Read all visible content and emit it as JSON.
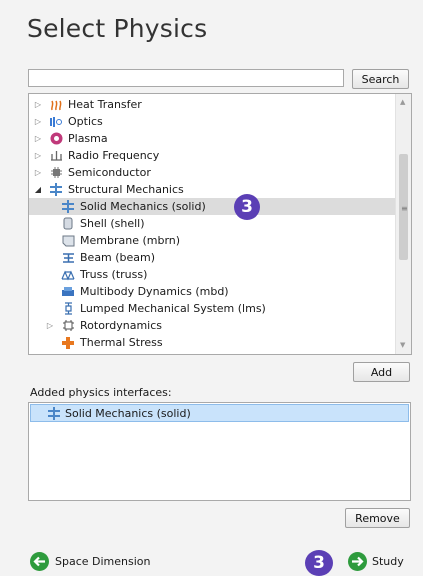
{
  "title": "Select Physics",
  "search": {
    "placeholder": "",
    "button_label": "Search"
  },
  "tree": {
    "items": [
      {
        "label": "Heat Transfer",
        "icon": "heat-transfer-icon",
        "expander": "collapsed"
      },
      {
        "label": "Optics",
        "icon": "optics-icon",
        "expander": "collapsed"
      },
      {
        "label": "Plasma",
        "icon": "plasma-icon",
        "expander": "collapsed"
      },
      {
        "label": "Radio Frequency",
        "icon": "radio-frequency-icon",
        "expander": "collapsed"
      },
      {
        "label": "Semiconductor",
        "icon": "semiconductor-icon",
        "expander": "collapsed"
      },
      {
        "label": "Structural Mechanics",
        "icon": "structural-mechanics-icon",
        "expander": "expanded"
      },
      {
        "label": "Solid Mechanics (solid)",
        "icon": "solid-mechanics-icon",
        "selected": true
      },
      {
        "label": "Shell (shell)",
        "icon": "shell-icon"
      },
      {
        "label": "Membrane (mbrn)",
        "icon": "membrane-icon"
      },
      {
        "label": "Beam (beam)",
        "icon": "beam-icon"
      },
      {
        "label": "Truss (truss)",
        "icon": "truss-icon"
      },
      {
        "label": "Multibody Dynamics (mbd)",
        "icon": "multibody-dynamics-icon"
      },
      {
        "label": "Lumped Mechanical System (lms)",
        "icon": "lumped-mechanical-system-icon"
      },
      {
        "label": "Rotordynamics",
        "icon": "rotordynamics-icon",
        "expander": "collapsed"
      },
      {
        "label": "Thermal Stress",
        "icon": "thermal-stress-icon"
      }
    ]
  },
  "badges": {
    "tree": "3",
    "footer": "3"
  },
  "add_button": "Add",
  "added": {
    "label": "Added physics interfaces:",
    "items": [
      {
        "label": "Solid Mechanics (solid)",
        "icon": "solid-mechanics-icon"
      }
    ]
  },
  "remove_button": "Remove",
  "nav": {
    "back_label": "Space Dimension",
    "next_label": "Study"
  },
  "colors": {
    "badge": "#5b3fb5",
    "nav_green": "#2e9b3d",
    "selected_row": "#dcdcdc",
    "added_row": "#c9e3fb"
  }
}
